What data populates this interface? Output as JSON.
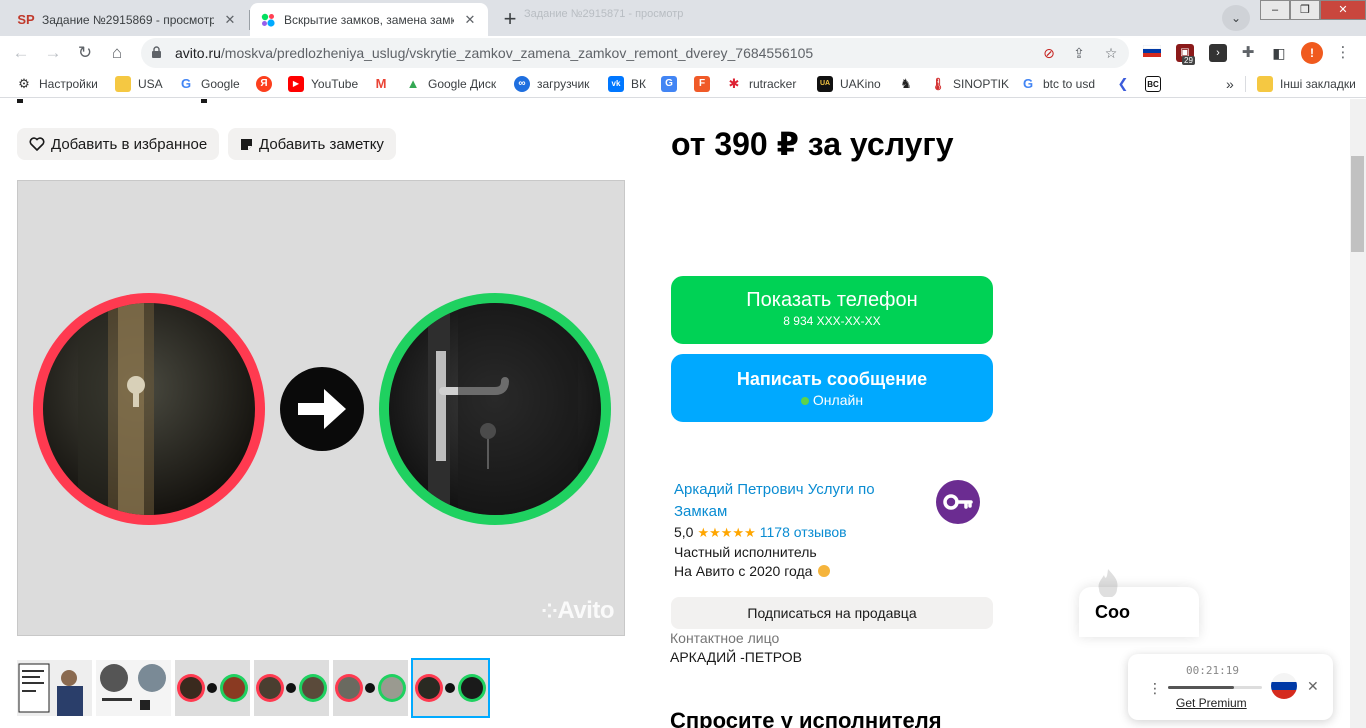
{
  "browser": {
    "tabs": [
      {
        "title": "Задание №2915869 - просмотр",
        "favicon": "SP"
      },
      {
        "title": "Вскрытие замков, замена замков",
        "favicon": "avito-dots"
      }
    ],
    "ghost_tab_text": "Задание №2915871 - просмотр",
    "url_host": "avito.ru",
    "url_path": "/moskva/predlozheniya_uslug/vskrytie_zamkov_zamena_zamkov_remont_dverey_7684556105",
    "extension_badge": "29",
    "profile_initial": "!",
    "window_controls": {
      "minimize": "–",
      "maximize": "❐",
      "close": "✕"
    }
  },
  "bookmarks": [
    {
      "label": "Настройки",
      "icon": "settings-icon"
    },
    {
      "label": "USA",
      "icon": "folder-icon"
    },
    {
      "label": "Google",
      "icon": "google-icon"
    },
    {
      "label": "",
      "icon": "yandex-icon"
    },
    {
      "label": "YouTube",
      "icon": "youtube-icon"
    },
    {
      "label": "",
      "icon": "gmail-icon"
    },
    {
      "label": "Google Диск",
      "icon": "drive-icon"
    },
    {
      "label": "загрузчик",
      "icon": "infinity-icon"
    },
    {
      "label": "ВК",
      "icon": "vk-icon"
    },
    {
      "label": "",
      "icon": "translate-icon"
    },
    {
      "label": "",
      "icon": "f-icon"
    },
    {
      "label": "rutracker",
      "icon": "rutracker-icon"
    },
    {
      "label": "UAKino",
      "icon": "uakino-icon"
    },
    {
      "label": "",
      "icon": "chess-icon"
    },
    {
      "label": "SINOPTIK",
      "icon": "thermometer-icon"
    },
    {
      "label": "btc to usd",
      "icon": "google-icon"
    },
    {
      "label": "",
      "icon": "arrow-icon"
    },
    {
      "label": "",
      "icon": "bc-icon"
    }
  ],
  "bookmarks_overflow": "»",
  "other_bookmarks": "Інші закладки",
  "listing": {
    "add_favorite": "Добавить в избранное",
    "add_note": "Добавить заметку",
    "watermark": "Avito",
    "price": "от 390 ₽ за услугу",
    "show_phone": "Показать телефон",
    "phone_masked": "8 934 XXX-XX-XX",
    "write_message": "Написать сообщение",
    "online_status": "Онлайн",
    "seller_name": "Аркадий Петрович Услуги по Замкам",
    "rating_value": "5,0",
    "stars": "★★★★★",
    "reviews": "1178 отзывов",
    "seller_type": "Частный исполнитель",
    "on_avito_since": "На Авито с 2020 года",
    "subscribe": "Подписаться на продавца",
    "contact_label": "Контактное лицо",
    "contact_name": "АРКАДИЙ -ПЕТРОВ",
    "ask_heading": "Спросите у исполнителя",
    "chat_label": "Соо"
  },
  "recorder": {
    "time": "00:21:19",
    "premium": "Get Premium",
    "progress": 0.7
  },
  "colors": {
    "accent_green": "#00d255",
    "accent_blue": "#00a9ff",
    "link": "#0a8cd2",
    "before_ring": "#ff3a50",
    "after_ring": "#1fd160"
  }
}
